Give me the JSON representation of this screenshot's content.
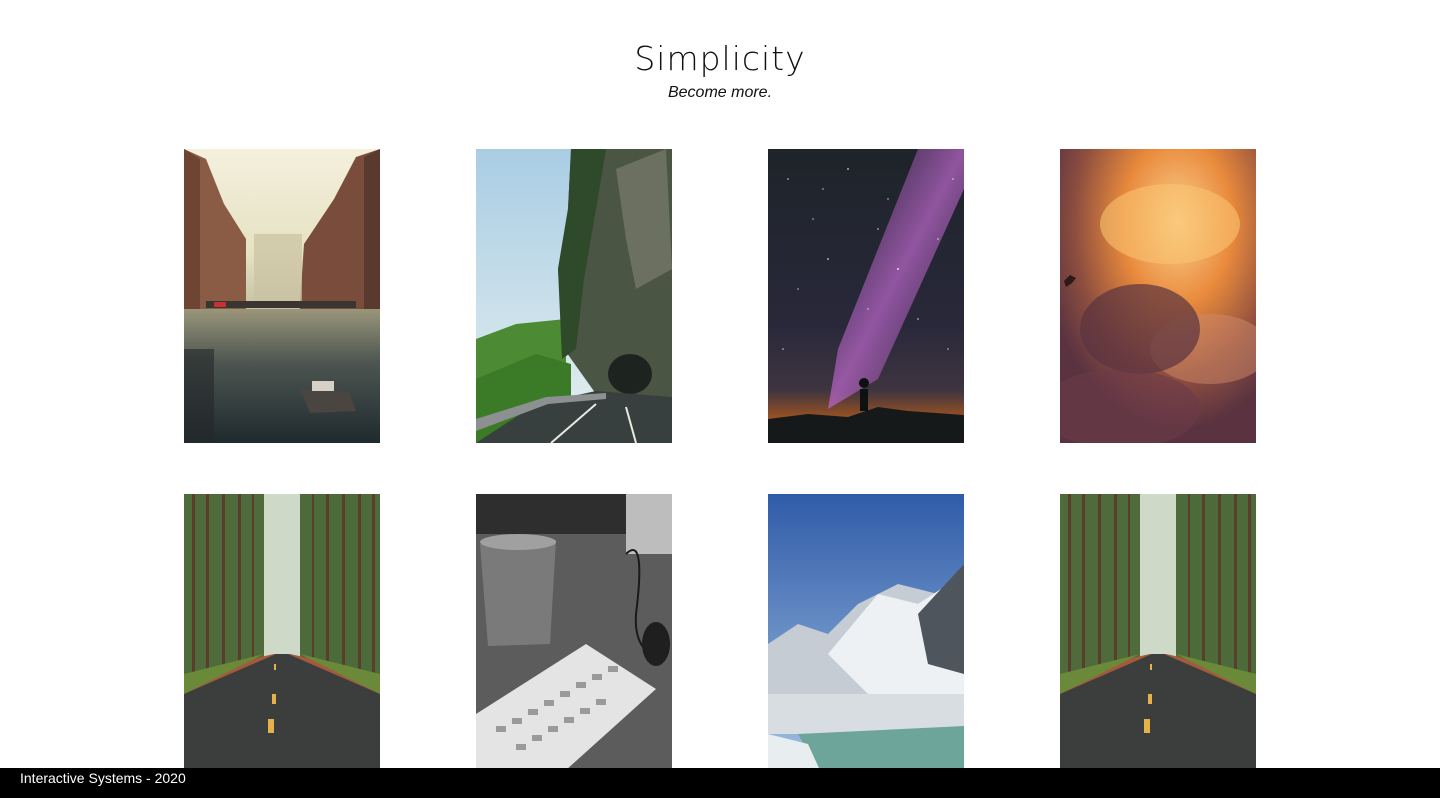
{
  "header": {
    "title": "Simplicity",
    "subtitle": "Become more."
  },
  "gallery": {
    "items": [
      {
        "name": "photo-canal-city",
        "subject": "canal with boat between brick buildings"
      },
      {
        "name": "photo-mountain-road-tunnel",
        "subject": "road along cliff into tunnel"
      },
      {
        "name": "photo-milky-way",
        "subject": "silhouette under milky way night sky"
      },
      {
        "name": "photo-sunset-clouds",
        "subject": "bird flying in orange clouds"
      },
      {
        "name": "photo-forest-road",
        "subject": "road through pine forest"
      },
      {
        "name": "photo-keyboard-desk",
        "subject": "black and white keyboard and cup on desk"
      },
      {
        "name": "photo-snowy-mountains",
        "subject": "snowy mountains with turquoise lake"
      },
      {
        "name": "photo-forest-road-2",
        "subject": "road through pine forest"
      }
    ]
  },
  "footer": {
    "text": "Interactive Systems - 2020"
  },
  "colors": {
    "background": "#ffffff",
    "text": "#111111",
    "footer_bg": "#000000",
    "footer_text": "#ffffff"
  }
}
